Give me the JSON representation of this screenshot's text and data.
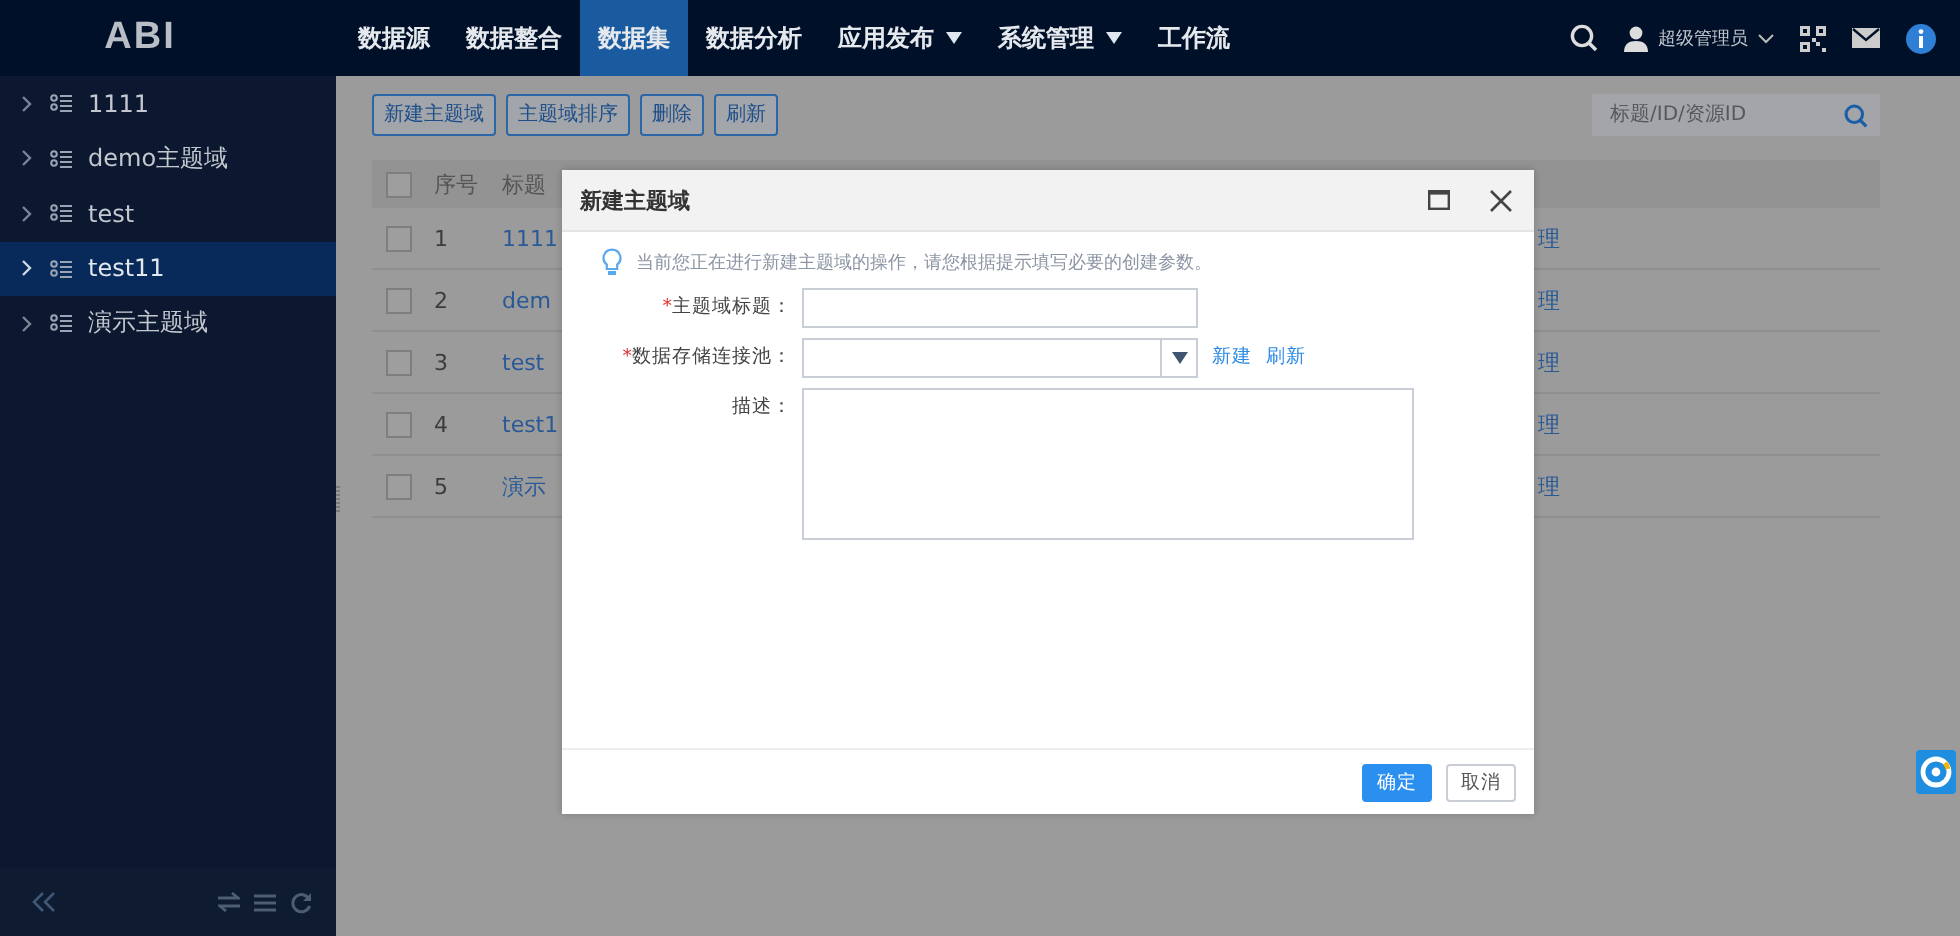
{
  "header": {
    "logo": "ABI",
    "nav": [
      {
        "label": "数据源",
        "selected": false,
        "has_menu": false
      },
      {
        "label": "数据整合",
        "selected": false,
        "has_menu": false
      },
      {
        "label": "数据集",
        "selected": true,
        "has_menu": false
      },
      {
        "label": "数据分析",
        "selected": false,
        "has_menu": false
      },
      {
        "label": "应用发布",
        "selected": false,
        "has_menu": true
      },
      {
        "label": "系统管理",
        "selected": false,
        "has_menu": true
      },
      {
        "label": "工作流",
        "selected": false,
        "has_menu": false
      }
    ],
    "user": "超级管理员"
  },
  "sidebar": {
    "items": [
      {
        "label": "1111",
        "selected": false
      },
      {
        "label": "demo主题域",
        "selected": false
      },
      {
        "label": "test",
        "selected": false
      },
      {
        "label": "test11",
        "selected": true
      },
      {
        "label": "演示主题域",
        "selected": false
      }
    ]
  },
  "toolbar": {
    "buttons": [
      "新建主题域",
      "主题域排序",
      "删除",
      "刷新"
    ],
    "search": {
      "placeholder": "标题/ID/资源ID"
    }
  },
  "table": {
    "all_checked": false,
    "columns": [
      "序号",
      "标题"
    ],
    "rows": [
      {
        "checked": false,
        "index": "1",
        "title": "1111",
        "column_3": "理"
      },
      {
        "checked": false,
        "index": "2",
        "title": "dem",
        "column_3": "理"
      },
      {
        "checked": false,
        "index": "3",
        "title": "test",
        "column_3": "理"
      },
      {
        "checked": false,
        "index": "4",
        "title": "test1",
        "column_3": "理"
      },
      {
        "checked": false,
        "index": "5",
        "title": "演示",
        "column_3": "理"
      }
    ]
  },
  "dialog": {
    "title": "新建主题域",
    "tip": "当前您正在进行新建主题域的操作，请您根据提示填写必要的创建参数。",
    "fields": [
      {
        "kind": "text",
        "mark": "*",
        "label": "主题域标题："
      },
      {
        "kind": "select",
        "mark": "*",
        "label": "数据存储连接池：",
        "links": [
          "新建",
          "刷新"
        ]
      },
      {
        "kind": "textarea",
        "label": "描述："
      }
    ],
    "buttons": [
      {
        "label": "确定",
        "kind": "primary"
      },
      {
        "label": "取消",
        "kind": "default"
      }
    ]
  }
}
